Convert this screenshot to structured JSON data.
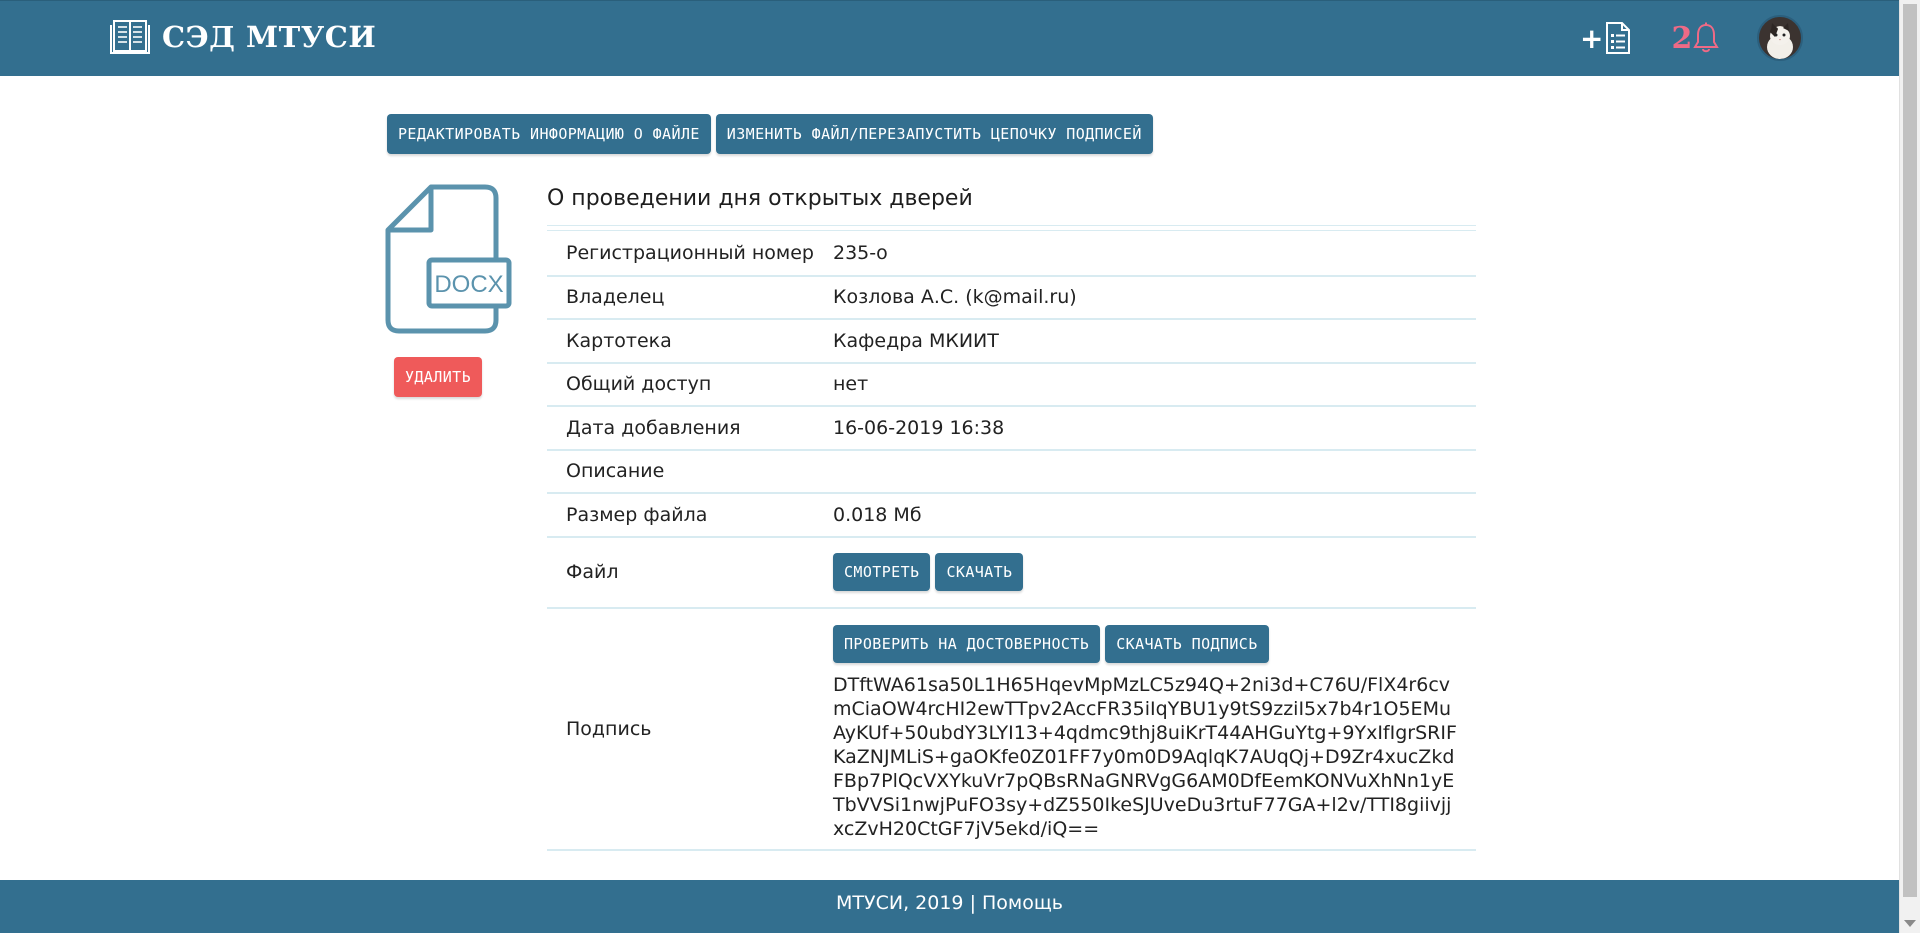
{
  "header": {
    "brand": "СЭД МТУСИ",
    "add_label": "+",
    "notification_count": "2"
  },
  "actions": {
    "edit_info": "Редактировать информацию о файле",
    "change_file": "Изменить файл/перезапустить цепочку подписей"
  },
  "file": {
    "type_label": "DOCX",
    "delete": "удалить",
    "title": "О проведении дня открытых дверей"
  },
  "details": {
    "rows": [
      {
        "label": "Регистрационный номер",
        "value": "235-о"
      },
      {
        "label": "Владелец",
        "value": "Козлова А.С. (k@mail.ru)"
      },
      {
        "label": "Картотека",
        "value": "Кафедра МКИИТ"
      },
      {
        "label": "Общий доступ",
        "value": "нет"
      },
      {
        "label": "Дата добавления",
        "value": "16-06-2019 16:38"
      },
      {
        "label": "Описание",
        "value": ""
      },
      {
        "label": "Размер файла",
        "value": "0.018 Мб"
      }
    ],
    "file_label": "Файл",
    "view_button": "Смотреть",
    "download_button": "Скачать",
    "signature_label": "Подпись",
    "verify_button": "Проверить на достоверность",
    "download_signature_button": "Скачать подпись",
    "signature_value": "DTftWA61sa50L1H65HqevMpMzLC5z94Q+2ni3d+C76U/FlX4r6cvmCiaOW4rcHI2ewTTpv2AccFR35iIqYBU1y9tS9zziI5x7b4r1O5EMuAyKUf+50ubdY3LYI13+4qdmc9thj8uiKrT44AHGuYtg+9YxIfIgrSRIFKaZNJMLiS+gaOKfe0Z01FF7y0m0D9AqlqK7AUqQj+D9Zr4xucZkdFBp7PlQcVXYkuVr7pQBsRNaGNRVgG6AM0DfEemKONVuXhNn1yETbVVSi1nwjPuFO3sy+dZ550IkeSJUveDu3rtuF77GA+l2v/TTI8giivjjxcZvH20CtGF7jV5ekd/iQ=="
  },
  "footer": {
    "copyright": "МТУСИ, 2019",
    "separator": "|",
    "help": "Помощь"
  }
}
